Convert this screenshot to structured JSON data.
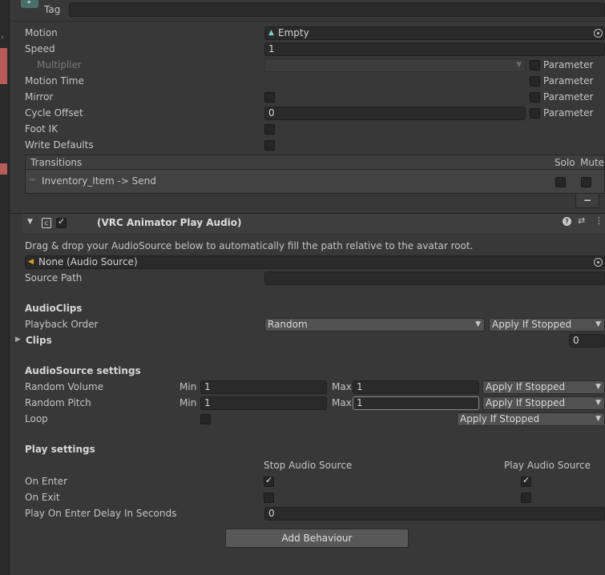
{
  "header": {
    "tag_label": "Tag",
    "tag_value": ""
  },
  "state": {
    "motion_label": "Motion",
    "motion_value": "Empty",
    "speed_label": "Speed",
    "speed_value": "1",
    "multiplier_label": "Multiplier",
    "motion_time_label": "Motion Time",
    "mirror_label": "Mirror",
    "cycle_offset_label": "Cycle Offset",
    "cycle_offset_value": "0",
    "foot_ik_label": "Foot IK",
    "write_defaults_label": "Write Defaults",
    "parameter_label": "Parameter"
  },
  "transitions": {
    "header": "Transitions",
    "solo": "Solo",
    "mute": "Mute",
    "items": [
      {
        "label": "Inventory_Item -> Send"
      }
    ],
    "remove_label": "−"
  },
  "component": {
    "title": "(VRC Animator Play Audio)",
    "enabled": true,
    "description": "Drag & drop your AudioSource below to automatically fill the path relative to the avatar root.",
    "audio_source_value": "None (Audio Source)",
    "source_path_label": "Source Path",
    "source_path_value": ""
  },
  "audio_clips": {
    "heading": "AudioClips",
    "playback_order_label": "Playback Order",
    "playback_order_value": "Random",
    "apply_value": "Apply If Stopped",
    "clips_label": "Clips",
    "clips_count": "0"
  },
  "audio_source_settings": {
    "heading": "AudioSource settings",
    "min_label": "Min",
    "max_label": "Max",
    "random_volume_label": "Random Volume",
    "volume_min": "1",
    "volume_max": "1",
    "random_pitch_label": "Random Pitch",
    "pitch_min": "1",
    "pitch_max": "1",
    "loop_label": "Loop",
    "apply_value": "Apply If Stopped"
  },
  "play_settings": {
    "heading": "Play settings",
    "stop_col": "Stop Audio Source",
    "play_col": "Play Audio Source",
    "on_enter_label": "On Enter",
    "on_exit_label": "On Exit",
    "delay_label": "Play On Enter Delay In Seconds",
    "delay_value": "0"
  },
  "add_behaviour_label": "Add Behaviour",
  "colors": {
    "panel_bg": "#383838",
    "field_bg": "#2a2a2a",
    "gutter_mark": "#b85a5a"
  }
}
